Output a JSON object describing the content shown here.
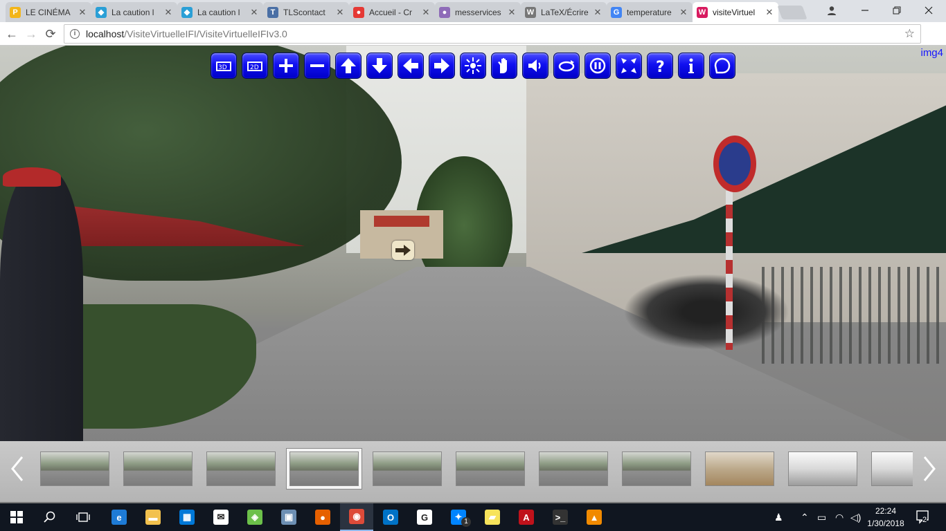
{
  "browser": {
    "tabs": [
      {
        "title": "LE CINÉMA",
        "favicon": "p-icon",
        "fav_color": "#f3b518",
        "fav_text": "P"
      },
      {
        "title": "La caution l",
        "favicon": "puzzle-icon",
        "fav_color": "#2a9fd6",
        "fav_text": "◆"
      },
      {
        "title": "La caution l",
        "favicon": "puzzle-icon",
        "fav_color": "#2a9fd6",
        "fav_text": "◆"
      },
      {
        "title": "TLScontact",
        "favicon": "t-icon",
        "fav_color": "#4a6fa5",
        "fav_text": "T"
      },
      {
        "title": "Accueil - Cr",
        "favicon": "crous-icon",
        "fav_color": "#e53935",
        "fav_text": "●"
      },
      {
        "title": "messervices",
        "favicon": "dots-icon",
        "fav_color": "#8e6bb8",
        "fav_text": "●"
      },
      {
        "title": "LaTeX/Écrire",
        "favicon": "wikibooks-icon",
        "fav_color": "#777777",
        "fav_text": "W"
      },
      {
        "title": "temperature",
        "favicon": "google-icon",
        "fav_color": "#4285f4",
        "fav_text": "G"
      },
      {
        "title": "visiteVirtuel",
        "favicon": "w3-icon",
        "fav_color": "#d81b60",
        "fav_text": "W"
      }
    ],
    "close_glyph": "✕",
    "address": {
      "host": "localhost",
      "path": "/VisiteVirtuelleIFI/VisiteVirtuelleIFIv3.0"
    }
  },
  "viewer": {
    "image_name": "img4",
    "controls": [
      {
        "name": "view-3d-icon"
      },
      {
        "name": "view-2d-icon"
      },
      {
        "name": "zoom-in-icon"
      },
      {
        "name": "zoom-out-icon"
      },
      {
        "name": "arrow-up-icon"
      },
      {
        "name": "arrow-down-icon"
      },
      {
        "name": "arrow-left-icon"
      },
      {
        "name": "arrow-right-icon"
      },
      {
        "name": "autorotate-icon"
      },
      {
        "name": "hand-icon"
      },
      {
        "name": "sound-icon"
      },
      {
        "name": "rotate-icon"
      },
      {
        "name": "pause-icon"
      },
      {
        "name": "fullscreen-icon"
      },
      {
        "name": "help-icon"
      },
      {
        "name": "info-icon"
      },
      {
        "name": "home-icon"
      }
    ],
    "thumbnails": [
      {
        "kind": "outdoor"
      },
      {
        "kind": "outdoor"
      },
      {
        "kind": "outdoor"
      },
      {
        "kind": "outdoor",
        "active": true
      },
      {
        "kind": "outdoor"
      },
      {
        "kind": "outdoor"
      },
      {
        "kind": "outdoor"
      },
      {
        "kind": "outdoor"
      },
      {
        "kind": "indoor"
      },
      {
        "kind": "stair"
      },
      {
        "kind": "stair",
        "partial": true
      }
    ]
  },
  "taskbar": {
    "apps": [
      {
        "name": "edge-icon",
        "color": "#1e7bd6",
        "glyph": "e"
      },
      {
        "name": "file-explorer-icon",
        "color": "#f2c14e",
        "glyph": "▬"
      },
      {
        "name": "store-icon",
        "color": "#0078d7",
        "glyph": "▦"
      },
      {
        "name": "mail-icon",
        "color": "#ffffff",
        "glyph": "✉"
      },
      {
        "name": "bluestacks-icon",
        "color": "#6cc04a",
        "glyph": "◈"
      },
      {
        "name": "photos-icon",
        "color": "#6d8fb3",
        "glyph": "▣"
      },
      {
        "name": "firefox-icon",
        "color": "#e66000",
        "glyph": "●"
      },
      {
        "name": "chrome-icon",
        "color": "#dd4b39",
        "glyph": "◉",
        "active": true
      },
      {
        "name": "outlook-icon",
        "color": "#0072c6",
        "glyph": "O"
      },
      {
        "name": "google-icon",
        "color": "#ffffff",
        "glyph": "G"
      },
      {
        "name": "messenger-icon",
        "color": "#0084ff",
        "glyph": "✦",
        "badge": "1"
      },
      {
        "name": "sticky-notes-icon",
        "color": "#f7e35b",
        "glyph": "▰"
      },
      {
        "name": "acrobat-icon",
        "color": "#c0121b",
        "glyph": "A"
      },
      {
        "name": "terminal-icon",
        "color": "#333333",
        "glyph": ">_"
      },
      {
        "name": "vlc-icon",
        "color": "#f18a00",
        "glyph": "▲"
      }
    ],
    "clock_time": "22:24",
    "clock_date": "1/30/2018",
    "notification_count": "2"
  }
}
